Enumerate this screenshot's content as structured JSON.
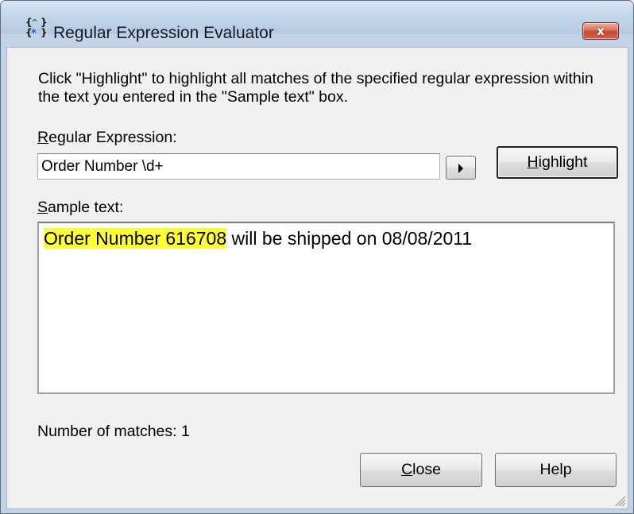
{
  "window": {
    "title": "Regular Expression Evaluator",
    "close_glyph": "x"
  },
  "description": "Click \"Highlight\" to highlight all matches of the specified regular expression within the text you entered in the \"Sample text\" box.",
  "regex": {
    "label_mnemonic": "R",
    "label_rest": "egular Expression:",
    "value": "Order Number \\d+"
  },
  "buttons": {
    "highlight_mnemonic": "H",
    "highlight_rest": "ighlight",
    "close_mnemonic": "C",
    "close_rest": "lose",
    "help": "Help"
  },
  "sample": {
    "label_mnemonic": "S",
    "label_rest": "ample text:",
    "matched_text": "Order Number 616708",
    "rest_text": " will be shipped on 08/08/2011",
    "highlight_color": "#ffff33"
  },
  "matches": {
    "label": "Number of matches: 1"
  },
  "icons": {
    "app": "regex-app-icon",
    "arrow": "right-triangle-icon",
    "grip": "resize-grip-icon"
  }
}
